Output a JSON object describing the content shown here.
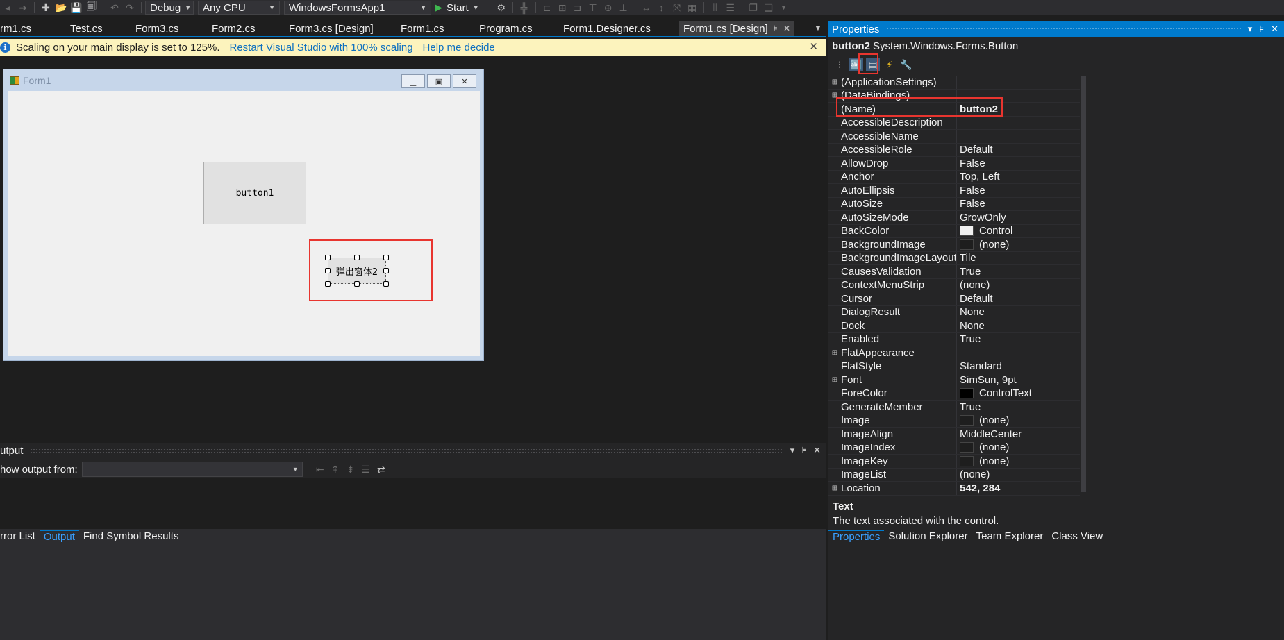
{
  "toolbar": {
    "config": "Debug",
    "platform": "Any CPU",
    "project": "WindowsFormsApp1",
    "start_label": "Start"
  },
  "tabs": [
    {
      "label": "rm1.cs"
    },
    {
      "label": "Test.cs"
    },
    {
      "label": "Form3.cs"
    },
    {
      "label": "Form2.cs"
    },
    {
      "label": "Form3.cs [Design]"
    },
    {
      "label": "Form1.cs"
    },
    {
      "label": "Program.cs"
    },
    {
      "label": "Form1.Designer.cs"
    },
    {
      "label": "Form1.cs [Design]"
    }
  ],
  "infobar": {
    "message": "Scaling on your main display is set to 125%.",
    "link1": "Restart Visual Studio with 100% scaling",
    "link2": "Help me decide"
  },
  "form": {
    "title": "Form1",
    "button1": "button1",
    "button2": "弹出窗体2"
  },
  "output": {
    "title": "utput",
    "show_from": "how output from:"
  },
  "bottom_tabs": [
    {
      "label": "rror List"
    },
    {
      "label": "Output"
    },
    {
      "label": "Find Symbol Results"
    }
  ],
  "properties": {
    "title": "Properties",
    "object_name": "button2",
    "object_type": "System.Windows.Forms.Button",
    "rows": [
      {
        "exp": "⊞",
        "name": "(ApplicationSettings)",
        "value": ""
      },
      {
        "exp": "⊞",
        "name": "(DataBindings)",
        "value": ""
      },
      {
        "exp": "",
        "name": "(Name)",
        "value": "button2",
        "bold": true
      },
      {
        "exp": "",
        "name": "AccessibleDescription",
        "value": ""
      },
      {
        "exp": "",
        "name": "AccessibleName",
        "value": ""
      },
      {
        "exp": "",
        "name": "AccessibleRole",
        "value": "Default"
      },
      {
        "exp": "",
        "name": "AllowDrop",
        "value": "False"
      },
      {
        "exp": "",
        "name": "Anchor",
        "value": "Top, Left"
      },
      {
        "exp": "",
        "name": "AutoEllipsis",
        "value": "False"
      },
      {
        "exp": "",
        "name": "AutoSize",
        "value": "False"
      },
      {
        "exp": "",
        "name": "AutoSizeMode",
        "value": "GrowOnly"
      },
      {
        "exp": "",
        "name": "BackColor",
        "value": "Control",
        "swatch": "#f0f0f0"
      },
      {
        "exp": "",
        "name": "BackgroundImage",
        "value": "(none)",
        "swatch": "#1e1e1e"
      },
      {
        "exp": "",
        "name": "BackgroundImageLayout",
        "value": "Tile"
      },
      {
        "exp": "",
        "name": "CausesValidation",
        "value": "True"
      },
      {
        "exp": "",
        "name": "ContextMenuStrip",
        "value": "(none)"
      },
      {
        "exp": "",
        "name": "Cursor",
        "value": "Default"
      },
      {
        "exp": "",
        "name": "DialogResult",
        "value": "None"
      },
      {
        "exp": "",
        "name": "Dock",
        "value": "None"
      },
      {
        "exp": "",
        "name": "Enabled",
        "value": "True"
      },
      {
        "exp": "⊞",
        "name": "FlatAppearance",
        "value": ""
      },
      {
        "exp": "",
        "name": "FlatStyle",
        "value": "Standard"
      },
      {
        "exp": "⊞",
        "name": "Font",
        "value": "SimSun, 9pt"
      },
      {
        "exp": "",
        "name": "ForeColor",
        "value": "ControlText",
        "swatch": "#000000"
      },
      {
        "exp": "",
        "name": "GenerateMember",
        "value": "True"
      },
      {
        "exp": "",
        "name": "Image",
        "value": "(none)",
        "swatch": "#1e1e1e"
      },
      {
        "exp": "",
        "name": "ImageAlign",
        "value": "MiddleCenter"
      },
      {
        "exp": "",
        "name": "ImageIndex",
        "value": "(none)",
        "swatch": "#1e1e1e"
      },
      {
        "exp": "",
        "name": "ImageKey",
        "value": "(none)",
        "swatch": "#1e1e1e"
      },
      {
        "exp": "",
        "name": "ImageList",
        "value": "(none)"
      },
      {
        "exp": "⊞",
        "name": "Location",
        "value": "542, 284",
        "bold": true
      }
    ],
    "desc_title": "Text",
    "desc_text": "The text associated with the control."
  },
  "props_tabs": [
    {
      "label": "Properties"
    },
    {
      "label": "Solution Explorer"
    },
    {
      "label": "Team Explorer"
    },
    {
      "label": "Class View"
    }
  ],
  "colors": {
    "accent": "#007acc",
    "highlight": "#e8352f",
    "infobar": "#fcf3bd"
  }
}
